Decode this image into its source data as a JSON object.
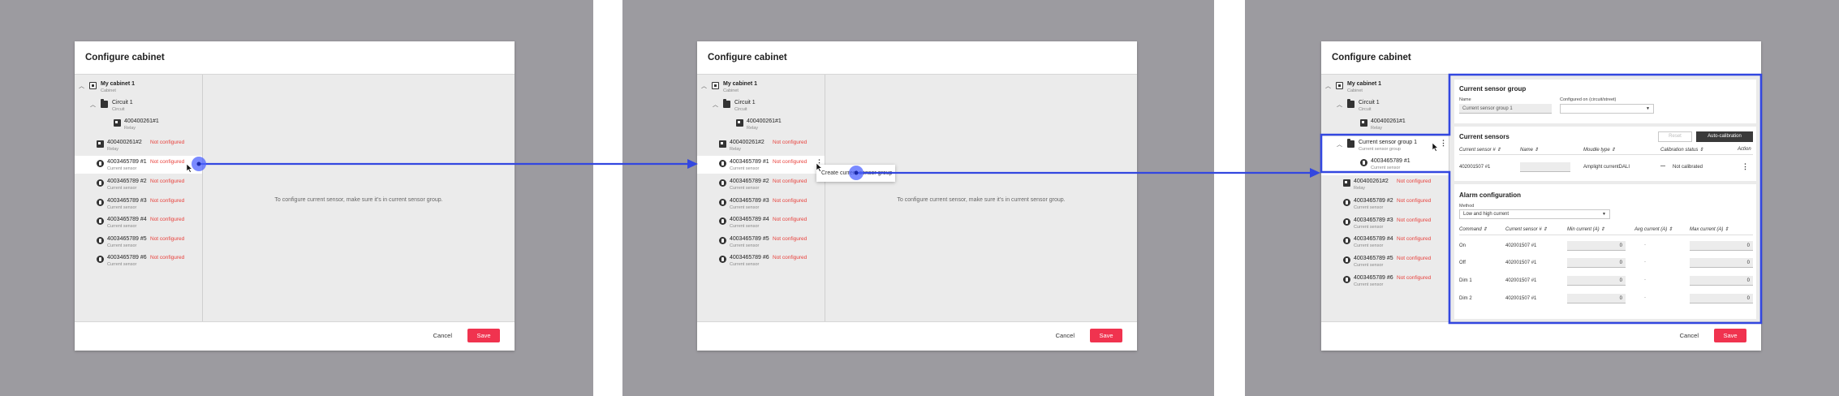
{
  "dialog": {
    "title": "Configure cabinet",
    "cancel_label": "Cancel",
    "save_label": "Save",
    "empty_message": "To configure current sensor, make sure it's in current sensor group."
  },
  "tree": {
    "cabinet": {
      "label": "My cabinet 1",
      "sub": "Cabinet"
    },
    "circuit": {
      "label": "Circuit 1",
      "sub": "Circuit"
    },
    "relay1": {
      "label": "400400261#1",
      "sub": "Relay"
    },
    "relay2": {
      "label": "400400261#2",
      "sub": "Relay",
      "status": "Not configured"
    },
    "sensors": [
      {
        "label": "40034657891",
        "display": "4003465789 #1",
        "sub": "Current sensor",
        "status": "Not configured"
      },
      {
        "label": "4003465789 #2",
        "sub": "Current sensor",
        "status": "Not configured"
      },
      {
        "label": "4003465789 #3",
        "sub": "Current sensor",
        "status": "Not configured"
      },
      {
        "label": "4003465789 #4",
        "sub": "Current sensor",
        "status": "Not configured"
      },
      {
        "label": "4003465789 #5",
        "sub": "Current sensor",
        "status": "Not configured"
      },
      {
        "label": "4003465789 #6",
        "sub": "Current sensor",
        "status": "Not configured"
      }
    ],
    "group": {
      "label": "Current sensor group 1",
      "sub": "Current sensor group"
    }
  },
  "context_menu": {
    "item": "Create current sensor group"
  },
  "group_panel": {
    "title": "Current sensor group",
    "name_label": "Name",
    "name_value": "Current sensor group 1",
    "configured_label": "Configured on (circuit/street)",
    "configured_value": ""
  },
  "sensors_panel": {
    "title": "Current sensors",
    "reset_label": "Reset",
    "autocal_label": "Auto-calibration",
    "headers": [
      "Current sensor #",
      "Name",
      "Moudle type",
      "Calibration status",
      "Action"
    ],
    "row": {
      "sensor": "402001507 #1",
      "name": "",
      "module": "Amplight currentDALI",
      "calibration": "Not calibrated"
    }
  },
  "alarm_panel": {
    "title": "Alarm configuration",
    "method_label": "Method",
    "method_value": "Low and high current",
    "headers": [
      "Command",
      "Current sensor #",
      "Min current (A)",
      "Avg current (A)",
      "Max current (A)"
    ],
    "rows": [
      {
        "command": "On",
        "sensor": "402001507 #1",
        "min": "0",
        "avg": "-",
        "max": "0"
      },
      {
        "command": "Off",
        "sensor": "402001507 #1",
        "min": "0",
        "avg": "-",
        "max": "0"
      },
      {
        "command": "Dim 1",
        "sensor": "402001507 #1",
        "min": "0",
        "avg": "-",
        "max": "0"
      },
      {
        "command": "Dim 2",
        "sensor": "402001507 #1",
        "min": "0",
        "avg": "-",
        "max": "0"
      }
    ]
  },
  "colors": {
    "accent": "#f0334f",
    "arrow": "#3347e0",
    "warning": "#e8413c",
    "frame": "#9c9ba0"
  }
}
